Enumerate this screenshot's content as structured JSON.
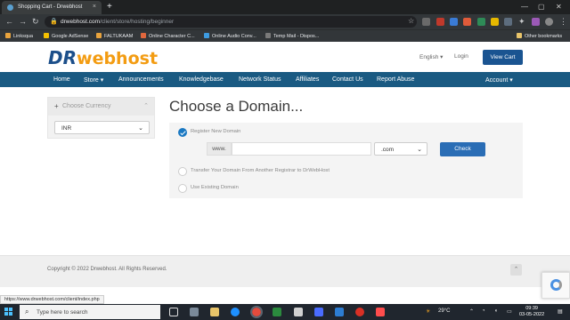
{
  "browser": {
    "tab_title": "Shopping Cart - Drwebhost",
    "tab_close": "×",
    "new_tab": "+",
    "url_host": "drwebhost.com",
    "url_path": "/client/store/hosting/beginner",
    "bookmarks": [
      {
        "label": "Linksqua",
        "color": "#e8a33d"
      },
      {
        "label": "Google AdSense",
        "color": "#f5c000"
      },
      {
        "label": "FALTUKAAM",
        "color": "#e8a33d"
      },
      {
        "label": "Online Character C...",
        "color": "#e0673d"
      },
      {
        "label": "Online Audio Conv...",
        "color": "#3d9be0"
      },
      {
        "label": "Temp Mail - Dispos...",
        "color": "#7a7a7a"
      }
    ],
    "other_bookmarks": "Other bookmarks"
  },
  "header": {
    "logo_dr": "DR",
    "logo_webhost": "webhost",
    "language": "English",
    "login": "Login",
    "view_cart": "View Cart"
  },
  "nav": {
    "items": [
      "Home",
      "Store",
      "Announcements",
      "Knowledgebase",
      "Network Status",
      "Affiliates",
      "Contact Us",
      "Report Abuse"
    ],
    "account": "Account"
  },
  "sidebar": {
    "currency_title": "Choose Currency",
    "currency_value": "INR"
  },
  "main": {
    "title": "Choose a Domain...",
    "options": [
      {
        "label": "Register New Domain",
        "selected": true
      },
      {
        "label": "Transfer Your Domain From Another Registrar to DrWebHost",
        "selected": false
      },
      {
        "label": "Use Existing Domain",
        "selected": false
      }
    ],
    "www_prefix": "www.",
    "domain_value": "",
    "tld_value": ".com",
    "check_button": "Check"
  },
  "footer": {
    "copyright": "Copyright © 2022 Drwebhost. All Rights Reserved."
  },
  "status_bar_url": "https://www.drwebhost.com/client/index.php",
  "taskbar": {
    "search_placeholder": "Type here to search",
    "weather": "29°C",
    "time": "09:39",
    "date": "03-05-2022"
  }
}
